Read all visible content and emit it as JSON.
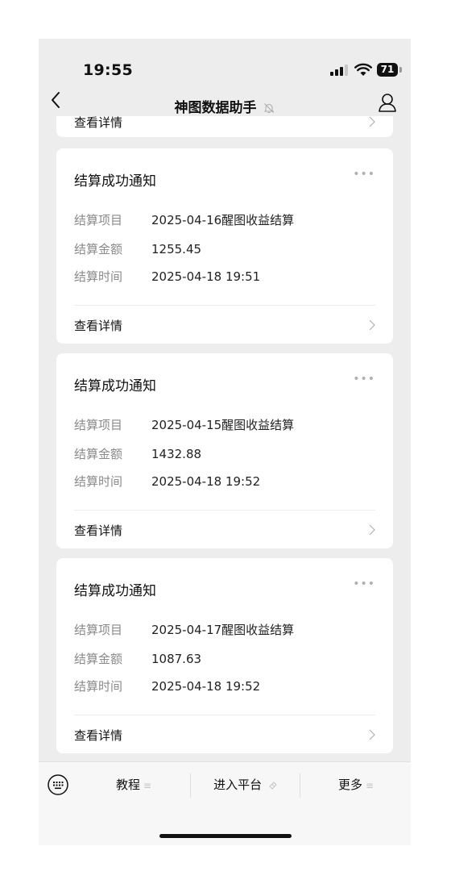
{
  "status_bar": {
    "time": "19:55",
    "battery": "71"
  },
  "nav": {
    "title": "神图数据助手"
  },
  "partial_card": {
    "detail_label": "查看详情"
  },
  "cards": [
    {
      "title": "结算成功通知",
      "rows": [
        {
          "label": "结算项目",
          "value": "2025-04-16醒图收益结算"
        },
        {
          "label": "结算金额",
          "value": "1255.45"
        },
        {
          "label": "结算时间",
          "value": "2025-04-18 19:51"
        }
      ],
      "detail_label": "查看详情"
    },
    {
      "title": "结算成功通知",
      "rows": [
        {
          "label": "结算项目",
          "value": "2025-04-15醒图收益结算"
        },
        {
          "label": "结算金额",
          "value": "1432.88"
        },
        {
          "label": "结算时间",
          "value": "2025-04-18 19:52"
        }
      ],
      "detail_label": "查看详情"
    },
    {
      "title": "结算成功通知",
      "rows": [
        {
          "label": "结算项目",
          "value": "2025-04-17醒图收益结算"
        },
        {
          "label": "结算金额",
          "value": "1087.63"
        },
        {
          "label": "结算时间",
          "value": "2025-04-18 19:52"
        }
      ],
      "detail_label": "查看详情"
    }
  ],
  "menu": {
    "items": [
      {
        "label": "教程"
      },
      {
        "label": "进入平台"
      },
      {
        "label": "更多"
      }
    ]
  },
  "icons": [
    "signal-icon",
    "wifi-icon",
    "battery-icon",
    "back-icon",
    "mute-icon",
    "profile-icon",
    "more-icon",
    "chevron-right-icon",
    "keyboard-icon",
    "menu-list-icon",
    "link-icon"
  ]
}
